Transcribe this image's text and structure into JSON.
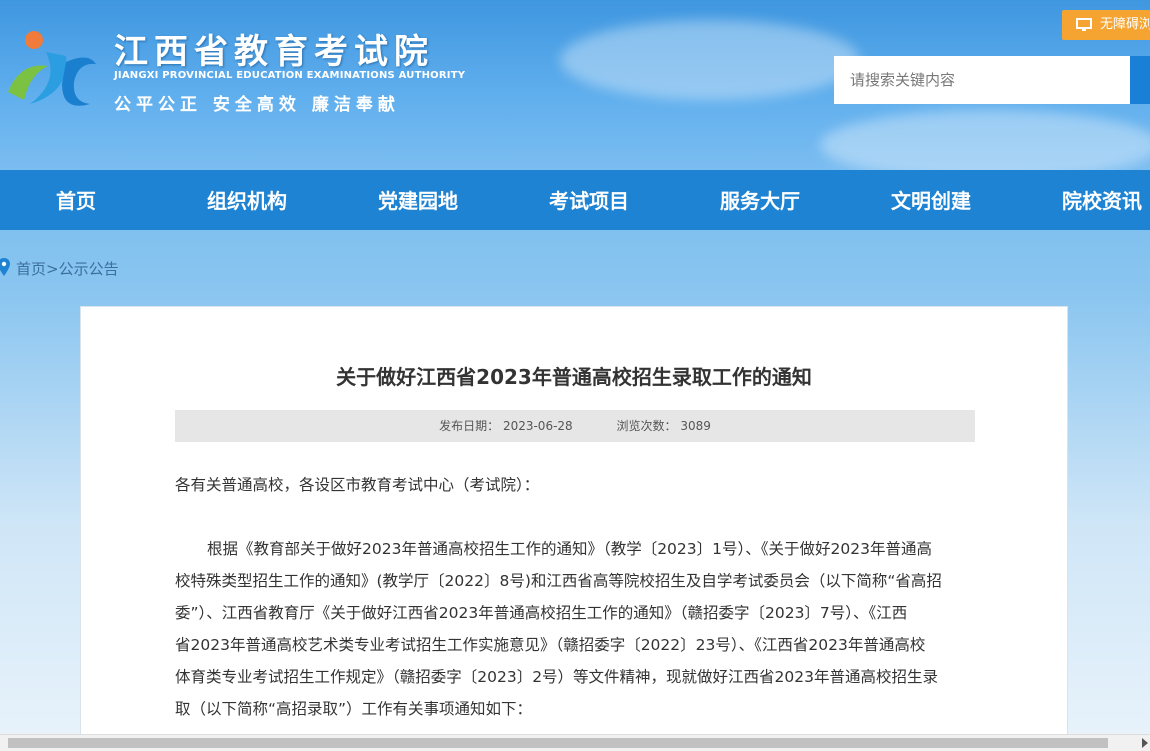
{
  "header": {
    "title_cn": "江西省教育考试院",
    "title_en": "JIANGXI PROVINCIAL EDUCATION EXAMINATIONS AUTHORITY",
    "slogan": "公平公正  安全高效  廉洁奉献",
    "accessibility_label": "无障碍浏览",
    "search": {
      "placeholder": "请搜索关键内容"
    }
  },
  "nav": {
    "items": [
      {
        "label": "首页"
      },
      {
        "label": "组织机构"
      },
      {
        "label": "党建园地"
      },
      {
        "label": "考试项目"
      },
      {
        "label": "服务大厅"
      },
      {
        "label": "文明创建"
      },
      {
        "label": "院校资讯"
      }
    ]
  },
  "breadcrumb": {
    "text": "首页>公示公告"
  },
  "article": {
    "title": "关于做好江西省2023年普通高校招生录取工作的通知",
    "publish_date": "发布日期：  2023-06-28",
    "view_count": "浏览次数：  3089",
    "salutation": "各有关普通高校，各设区市教育考试中心（考试院）：",
    "paragraph_lines": [
      "根据《教育部关于做好2023年普通高校招生工作的通知》（教学〔2023〕1号）、《关于做好2023年普通高",
      "校特殊类型招生工作的通知》(教学厅〔2022〕8号)和江西省高等院校招生及自学考试委员会（以下简称“省高招",
      "委”）、江西省教育厅《关于做好江西省2023年普通高校招生工作的通知》（赣招委字〔2023〕7号）、《江西",
      "省2023年普通高校艺术类专业考试招生工作实施意见》（赣招委字〔2022〕23号）、《江西省2023年普通高校",
      "体育类专业考试招生工作规定》（赣招委字〔2023〕2号）等文件精神，现就做好江西省2023年普通高校招生录",
      "取（以下简称“高招录取”）工作有关事项通知如下："
    ]
  },
  "colors": {
    "nav_bg": "#1e83d3",
    "accent_orange": "#f5a431",
    "header_sky": "#4fa4e8"
  }
}
